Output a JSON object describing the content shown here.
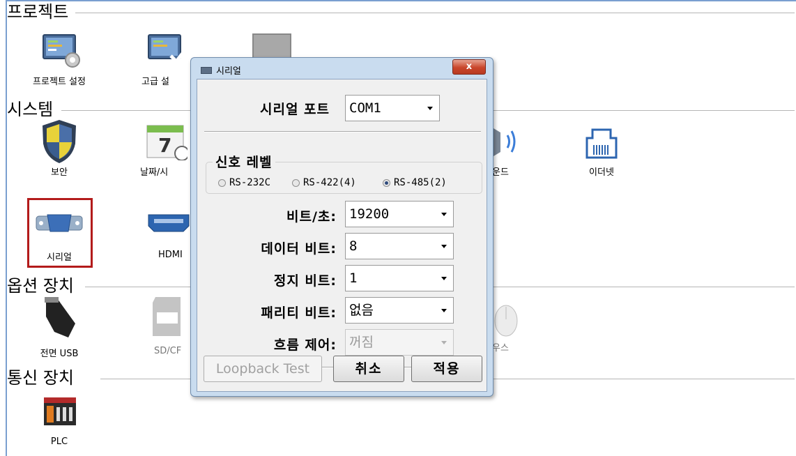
{
  "sections": {
    "project": "프로젝트",
    "system": "시스템",
    "options": "옵션 장치",
    "comm": "통신 장치"
  },
  "icons": {
    "project_settings": "프로젝트 설정",
    "advanced_settings": "고급 설",
    "security": "보안",
    "datetime": "날짜/시",
    "sound": "운드",
    "ethernet": "이더넷",
    "serial": "시리얼",
    "hdmi": "HDMI",
    "front_usb": "전면 USB",
    "sdcf": "SD/CF",
    "mouse": "우스",
    "plc": "PLC"
  },
  "dialog": {
    "title": "시리얼",
    "close": "x",
    "serial_port_label": "시리얼 포트",
    "serial_port_value": "COM1",
    "signal_level_title": "신호 레벨",
    "radios": [
      "RS-232C",
      "RS-422(4)",
      "RS-485(2)"
    ],
    "selected_radio": "RS-485(2)",
    "baud_label": "비트/초:",
    "baud_value": "19200",
    "data_bits_label": "데이터 비트:",
    "data_bits_value": "8",
    "stop_bits_label": "정지 비트:",
    "stop_bits_value": "1",
    "parity_label": "패리티 비트:",
    "parity_value": "없음",
    "flow_label": "흐름 제어:",
    "flow_value": "꺼짐",
    "loopback": "Loopback Test",
    "cancel": "취소",
    "apply": "적용"
  },
  "colors": {
    "highlight_border": "#b31b1b",
    "dialog_frame": "#c9dcef",
    "close_button": "#c9462b"
  }
}
